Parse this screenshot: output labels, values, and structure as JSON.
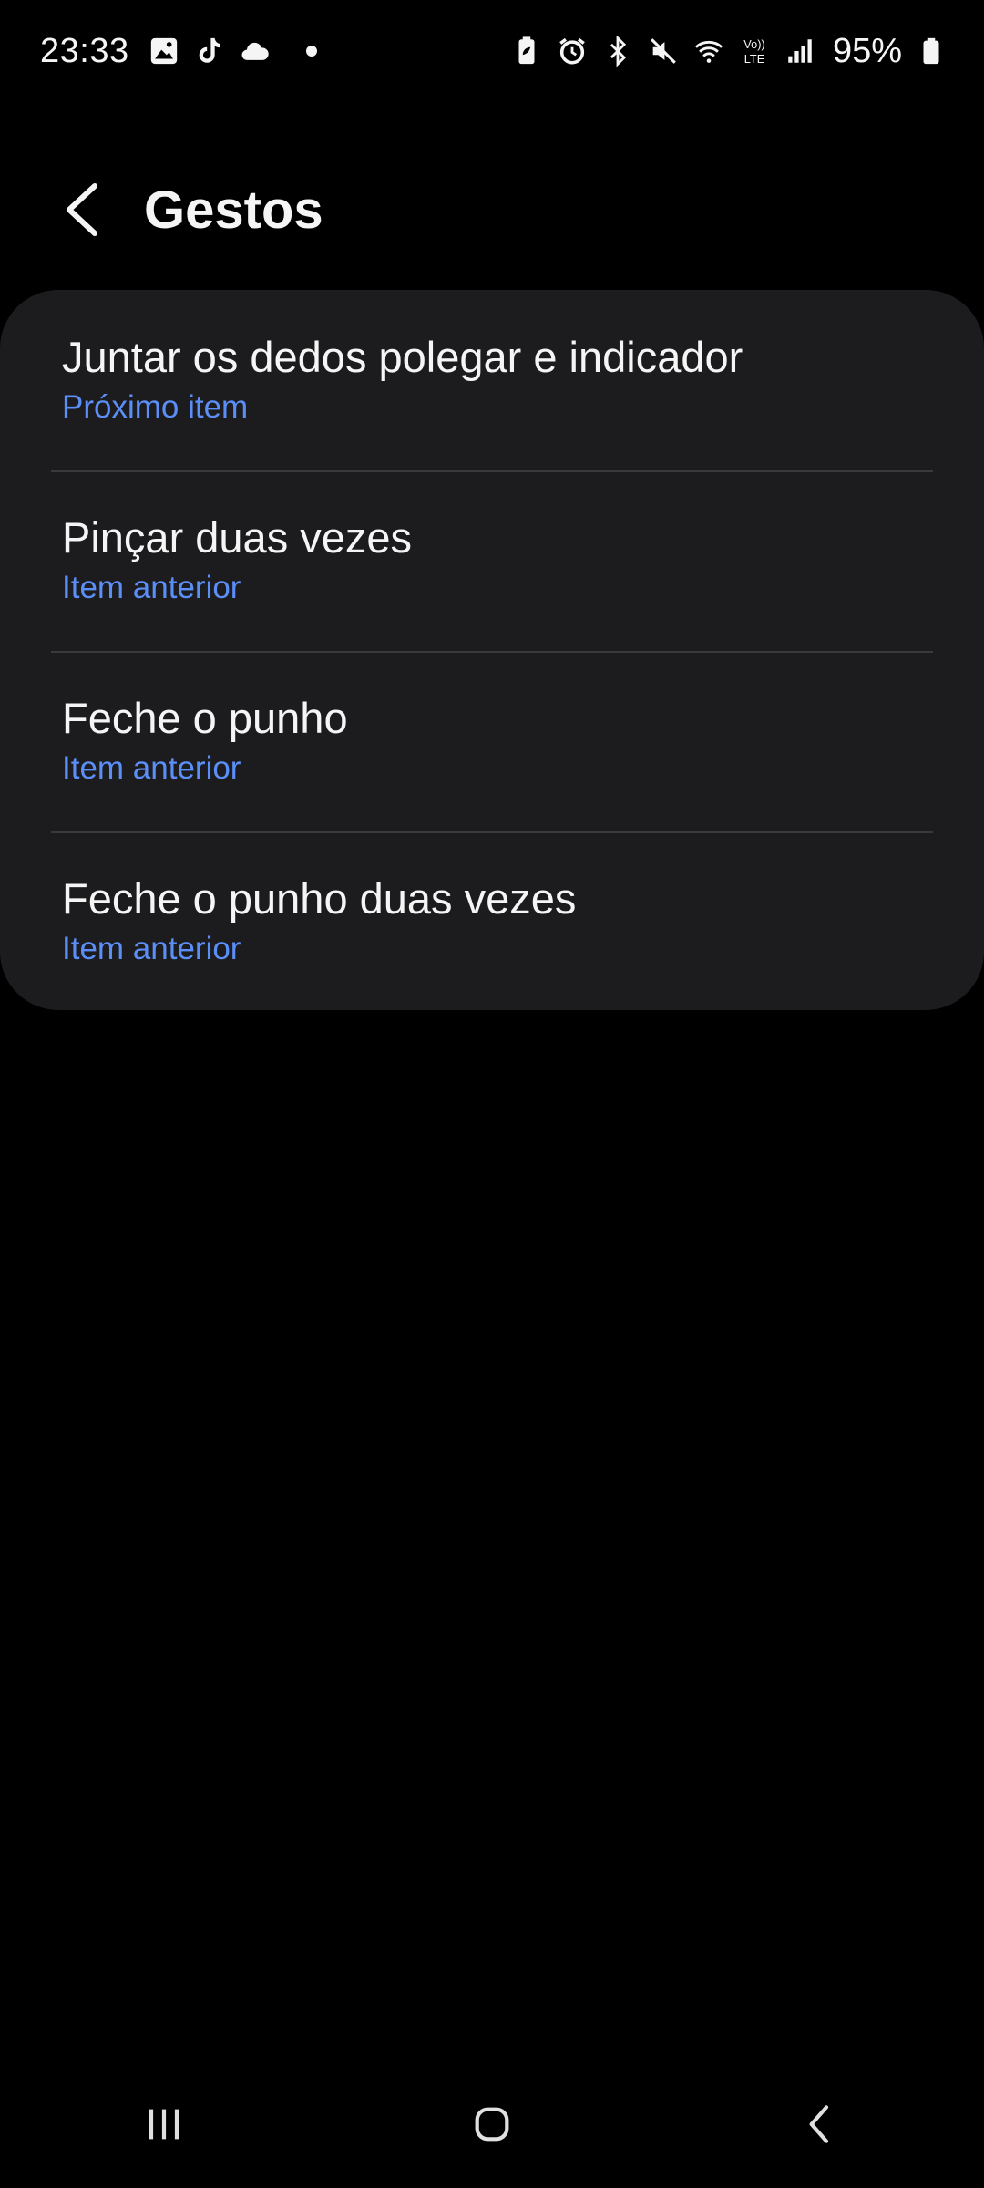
{
  "status_bar": {
    "time": "23:33",
    "battery_percent": "95%",
    "left_icons": [
      "gallery-icon",
      "tiktok-icon",
      "cloud-icon",
      "dot-icon"
    ],
    "right_icons": [
      "battery-saver-icon",
      "alarm-icon",
      "bluetooth-icon",
      "mute-icon",
      "wifi-icon",
      "volte-icon",
      "signal-icon",
      "battery-icon"
    ],
    "volte_label_top": "Vo))",
    "volte_label_bottom": "LTE"
  },
  "header": {
    "title": "Gestos"
  },
  "gesture_list": {
    "items": [
      {
        "title": "Juntar os dedos polegar e indicador",
        "subtitle": "Próximo item"
      },
      {
        "title": "Pinçar duas vezes",
        "subtitle": "Item anterior"
      },
      {
        "title": "Feche o punho",
        "subtitle": "Item anterior"
      },
      {
        "title": "Feche o punho duas vezes",
        "subtitle": "Item anterior"
      }
    ]
  },
  "nav_bar": {
    "buttons": [
      "recent-apps",
      "home",
      "back"
    ]
  },
  "colors": {
    "background": "#000000",
    "card": "#1c1c1e",
    "divider": "#3a3a3c",
    "text_primary": "#f5f5f5",
    "accent_subtitle": "#5b8ef6"
  }
}
